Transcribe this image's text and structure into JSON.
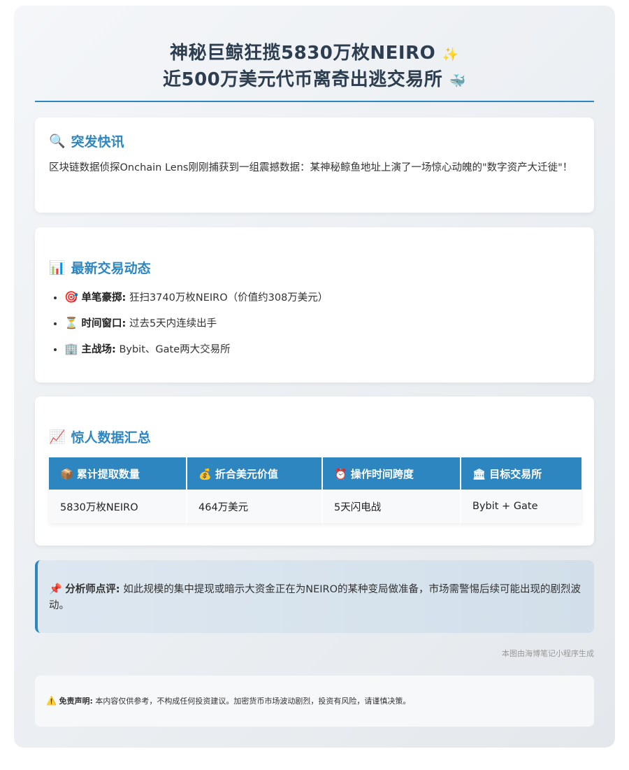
{
  "header": {
    "title_line1": "神秘巨鲸狂揽5830万枚NEIRO",
    "title_line1_emoji": "✨",
    "title_line2": "近500万美元代币离奇出逃交易所",
    "title_line2_emoji": "🐳"
  },
  "breaking": {
    "icon": "🔍",
    "heading": "突发快讯",
    "text": "区块链数据侦探Onchain Lens刚刚捕获到一组震撼数据：某神秘鲸鱼地址上演了一场惊心动魄的\"数字资产大迁徙\"！"
  },
  "latest": {
    "icon": "📊",
    "heading": "最新交易动态",
    "items": [
      {
        "icon": "🎯",
        "label": "单笔豪掷:",
        "text": "狂扫3740万枚NEIRO（价值约308万美元）"
      },
      {
        "icon": "⏳",
        "label": "时间窗口:",
        "text": "过去5天内连续出手"
      },
      {
        "icon": "🏢",
        "label": "主战场:",
        "text": "Bybit、Gate两大交易所"
      }
    ]
  },
  "summary": {
    "icon": "📈",
    "heading": "惊人数据汇总",
    "columns": [
      {
        "icon": "📦",
        "label": "累计提取数量"
      },
      {
        "icon": "💰",
        "label": "折合美元价值"
      },
      {
        "icon": "⏰",
        "label": "操作时间跨度"
      },
      {
        "icon": "🏛",
        "label": "目标交易所"
      }
    ],
    "row": [
      "5830万枚NEIRO",
      "464万美元",
      "5天闪电战",
      "Bybit + Gate"
    ]
  },
  "analyst": {
    "icon": "📌",
    "label": "分析师点评:",
    "text": "如此规模的集中提现或暗示大资金正在为NEIRO的某种变局做准备，市场需警惕后续可能出现的剧烈波动。"
  },
  "source_note": "本图由海博笔记小程序生成",
  "disclaimer": {
    "icon": "⚠️",
    "label": "免责声明:",
    "text": "本内容仅供参考，不构成任何投资建议。加密货币市场波动剧烈，投资有风险，请谨慎决策。"
  }
}
